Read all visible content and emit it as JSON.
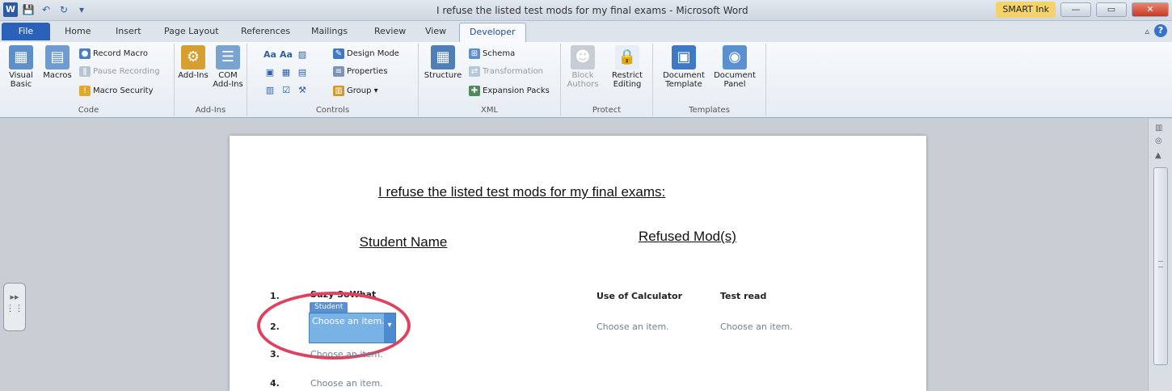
{
  "window": {
    "title": "I refuse the listed test mods for my final exams - Microsoft Word",
    "smartink_label": "SMART Ink",
    "minimize": "—",
    "maximize": "▭",
    "close": "✕"
  },
  "qat": {
    "logo": "W",
    "save": "💾",
    "undo": "↶",
    "redo": "↻",
    "customize": "▾"
  },
  "tabs": {
    "file": "File",
    "items": [
      "Home",
      "Insert",
      "Page Layout",
      "References",
      "Mailings",
      "Review",
      "View",
      "Developer"
    ],
    "active": "Developer"
  },
  "ribbon": {
    "code": {
      "label": "Code",
      "visual_basic": "Visual Basic",
      "macros": "Macros",
      "record_macro": "Record Macro",
      "pause_recording": "Pause Recording",
      "macro_security": "Macro Security"
    },
    "addins": {
      "label": "Add-Ins",
      "addins": "Add-Ins",
      "com_addins": "COM Add-Ins"
    },
    "controls": {
      "label": "Controls",
      "design_mode": "Design Mode",
      "properties": "Properties",
      "group": "Group ▾"
    },
    "xml": {
      "label": "XML",
      "structure": "Structure",
      "schema": "Schema",
      "transformation": "Transformation",
      "expansion_packs": "Expansion Packs"
    },
    "protect": {
      "label": "Protect",
      "block_authors": "Block Authors",
      "restrict_editing": "Restrict Editing"
    },
    "templates": {
      "label": "Templates",
      "document_template": "Document Template",
      "document_panel": "Document Panel"
    }
  },
  "document": {
    "heading": "I refuse the listed test mods for my final exams:",
    "col_student": "Student Name",
    "col_refused": "Refused Mod(s)",
    "rows": [
      {
        "num": "1.",
        "student": "Suzy SoWhat",
        "mod1": "Use of Calculator",
        "mod2": "Test read"
      },
      {
        "num": "2.",
        "student": "Choose an item.",
        "mod1": "Choose an item.",
        "mod2": "Choose an item."
      },
      {
        "num": "3.",
        "student": "Choose an item."
      },
      {
        "num": "4.",
        "student": "Choose an item."
      }
    ],
    "content_control_tag": "Student"
  }
}
